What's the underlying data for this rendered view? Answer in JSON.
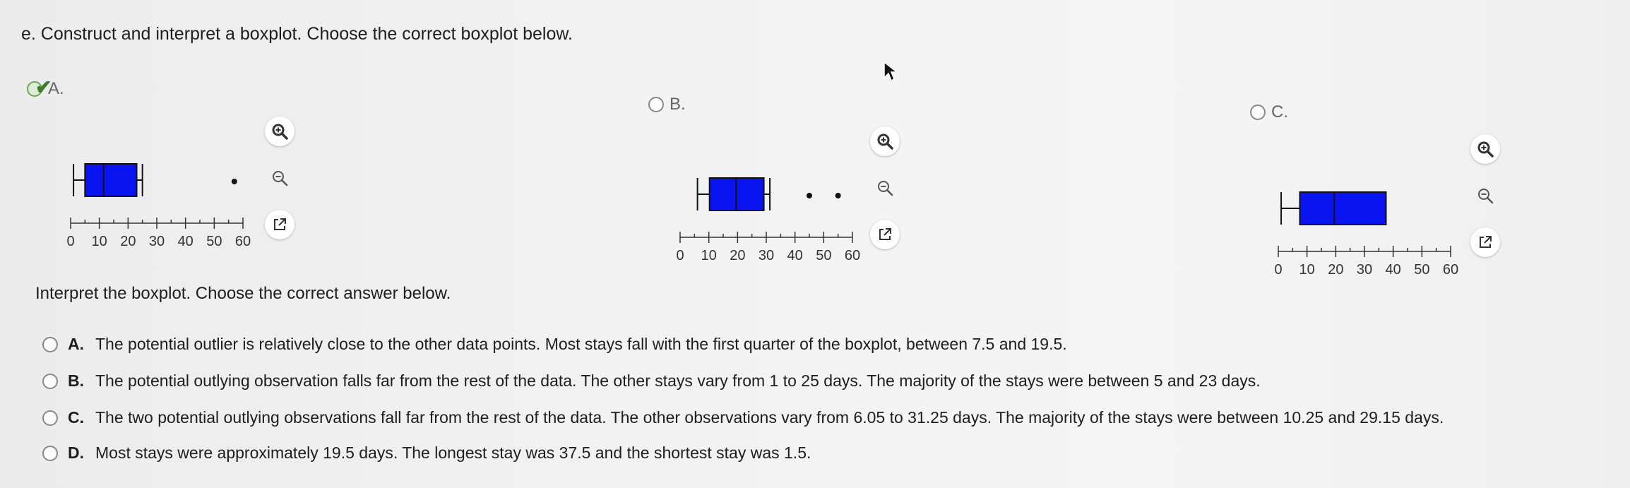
{
  "question": "e. Construct and interpret a boxplot. Choose the correct boxplot below.",
  "boxplot_options": [
    {
      "label": "A.",
      "selected": true
    },
    {
      "label": "B.",
      "selected": false
    },
    {
      "label": "C.",
      "selected": false
    }
  ],
  "axis_ticks": [
    "0",
    "10",
    "20",
    "30",
    "40",
    "50",
    "60"
  ],
  "chart_data": [
    {
      "type": "boxplot",
      "option": "A",
      "min": 1,
      "q1": 5,
      "median": 11.5,
      "q3": 23,
      "max": 25,
      "outliers": [
        57
      ],
      "xlim": [
        0,
        60
      ]
    },
    {
      "type": "boxplot",
      "option": "B",
      "min": 6.05,
      "q1": 10.25,
      "median": 19.5,
      "q3": 29.15,
      "max": 31.25,
      "outliers": [
        45,
        55
      ],
      "xlim": [
        0,
        60
      ]
    },
    {
      "type": "boxplot",
      "option": "C",
      "min": 1,
      "q1": 7.5,
      "median": 19.5,
      "q3": 37.5,
      "max": 37.5,
      "outliers": [],
      "xlim": [
        0,
        60
      ]
    }
  ],
  "interpret_prompt": "Interpret the boxplot. Choose the correct answer below.",
  "answers": [
    {
      "letter": "A.",
      "text": "The potential outlier is relatively close to the other data points. Most stays fall with the first quarter of the boxplot, between 7.5 and 19.5."
    },
    {
      "letter": "B.",
      "text": "The potential outlying observation falls far from the rest of the data. The other stays vary from 1 to 25 days. The majority of the stays were between 5 and 23 days."
    },
    {
      "letter": "C.",
      "text": "The two potential outlying observations fall far from the rest of the data. The other observations vary from 6.05 to 31.25 days. The majority of the stays were between 10.25 and  29.15 days."
    },
    {
      "letter": "D.",
      "text": "Most stays were approximately 19.5 days. The longest stay was 37.5 and the shortest stay was 1.5."
    }
  ],
  "colors": {
    "box_fill": "#0a14f0",
    "check": "#3f7d2e"
  },
  "icons": [
    "zoom-in-icon",
    "zoom-out-icon",
    "external-link-icon",
    "checkmark-icon",
    "mouse-cursor-icon"
  ]
}
